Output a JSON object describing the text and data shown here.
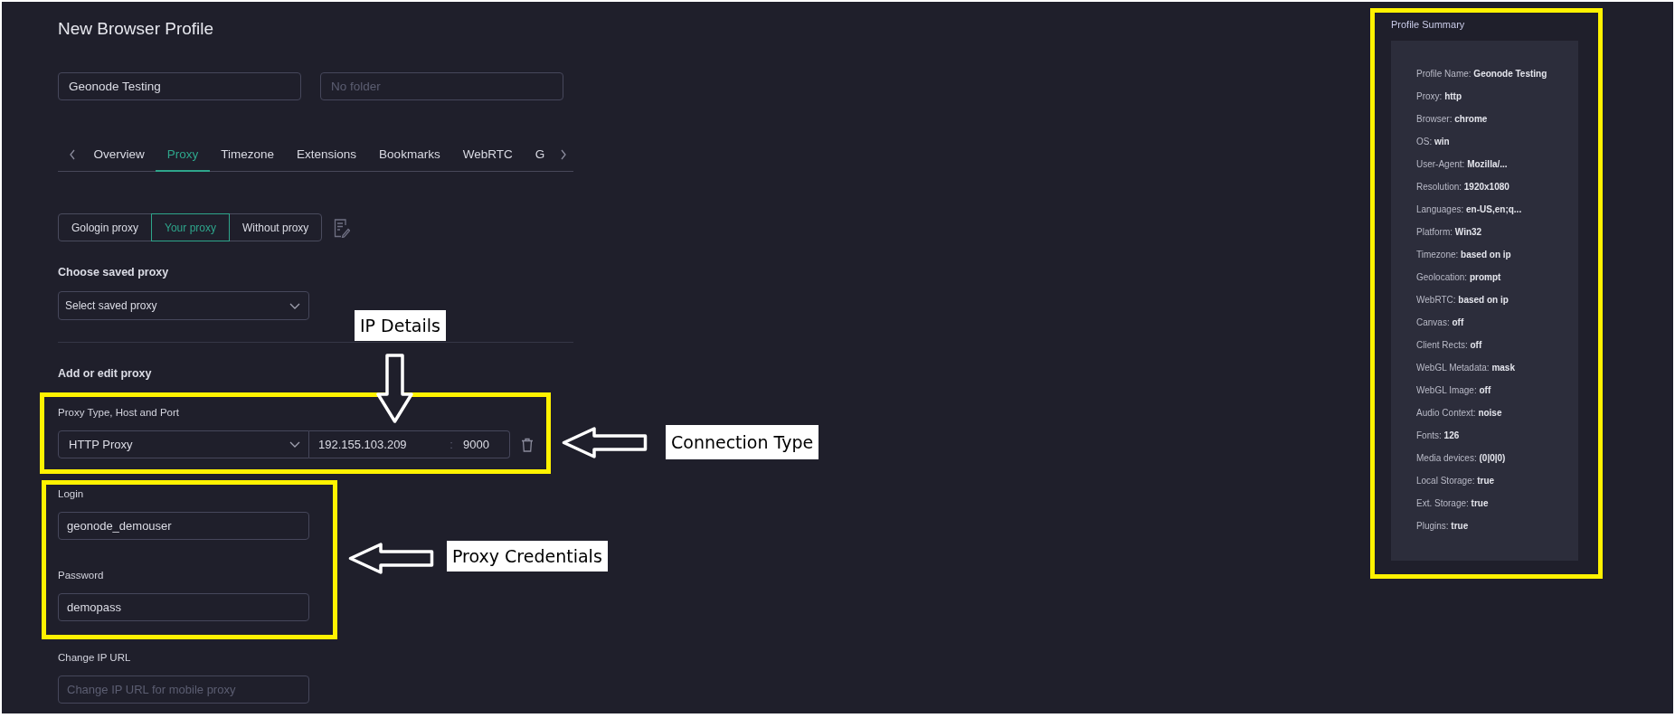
{
  "page": {
    "title": "New Browser Profile"
  },
  "profile_fields": {
    "name": {
      "value": "Geonode Testing"
    },
    "folder": {
      "placeholder": "No folder"
    }
  },
  "tabs": [
    {
      "label": "Overview",
      "selected": false
    },
    {
      "label": "Proxy",
      "selected": true
    },
    {
      "label": "Timezone",
      "selected": false
    },
    {
      "label": "Extensions",
      "selected": false
    },
    {
      "label": "Bookmarks",
      "selected": false
    },
    {
      "label": "WebRTC",
      "selected": false
    },
    {
      "label": "G",
      "selected": false
    }
  ],
  "proxy_modes": [
    {
      "label": "Gologin proxy",
      "selected": false
    },
    {
      "label": "Your proxy",
      "selected": true
    },
    {
      "label": "Without proxy",
      "selected": false
    }
  ],
  "saved_proxy": {
    "heading": "Choose saved proxy",
    "select": "Select saved proxy"
  },
  "edit_proxy": {
    "heading": "Add or edit proxy"
  },
  "proxy_address": {
    "label": "Proxy Type, Host and Port",
    "type": "HTTP Proxy",
    "host": "192.155.103.209",
    "separator": ":",
    "port": "9000",
    "highlighted": true
  },
  "credentials": {
    "highlighted": true,
    "login": {
      "label": "Login",
      "value": "geonode_demouser"
    },
    "password": {
      "label": "Password",
      "value": "demopass"
    }
  },
  "change_ip_url": {
    "label": "Change IP URL",
    "placeholder": "Change IP URL for mobile proxy"
  },
  "profile_summary": {
    "title": "Profile Summary",
    "highlighted": true,
    "items": [
      "Profile Name: **Geonode Testing**",
      "Proxy: **http**",
      "Browser: **chrome**",
      "OS: **win**",
      "User-Agent: **Mozilla/...**",
      "Resolution: **1920x1080**",
      "Languages: **en-US,en;q...**",
      "Platform: **Win32**",
      "Timezone: **based on ip**",
      "Geolocation: **prompt**",
      "WebRTC: **based on ip**",
      "Canvas: **off**",
      "Client Rects: **off**",
      "WebGL Metadata: **mask**",
      "WebGL Image: **off**",
      "Audio Context: **noise**",
      "Fonts: **126**",
      "Media devices: **(0|0|0)**",
      "Local Storage: **true**",
      "Ext. Storage: **true**",
      "Plugins: **true**"
    ]
  },
  "callouts": [
    {
      "text": "IP Details",
      "kind": "down"
    },
    {
      "text": "Connection Type",
      "kind": "left"
    },
    {
      "text": "Proxy Credentials",
      "kind": "left"
    }
  ]
}
